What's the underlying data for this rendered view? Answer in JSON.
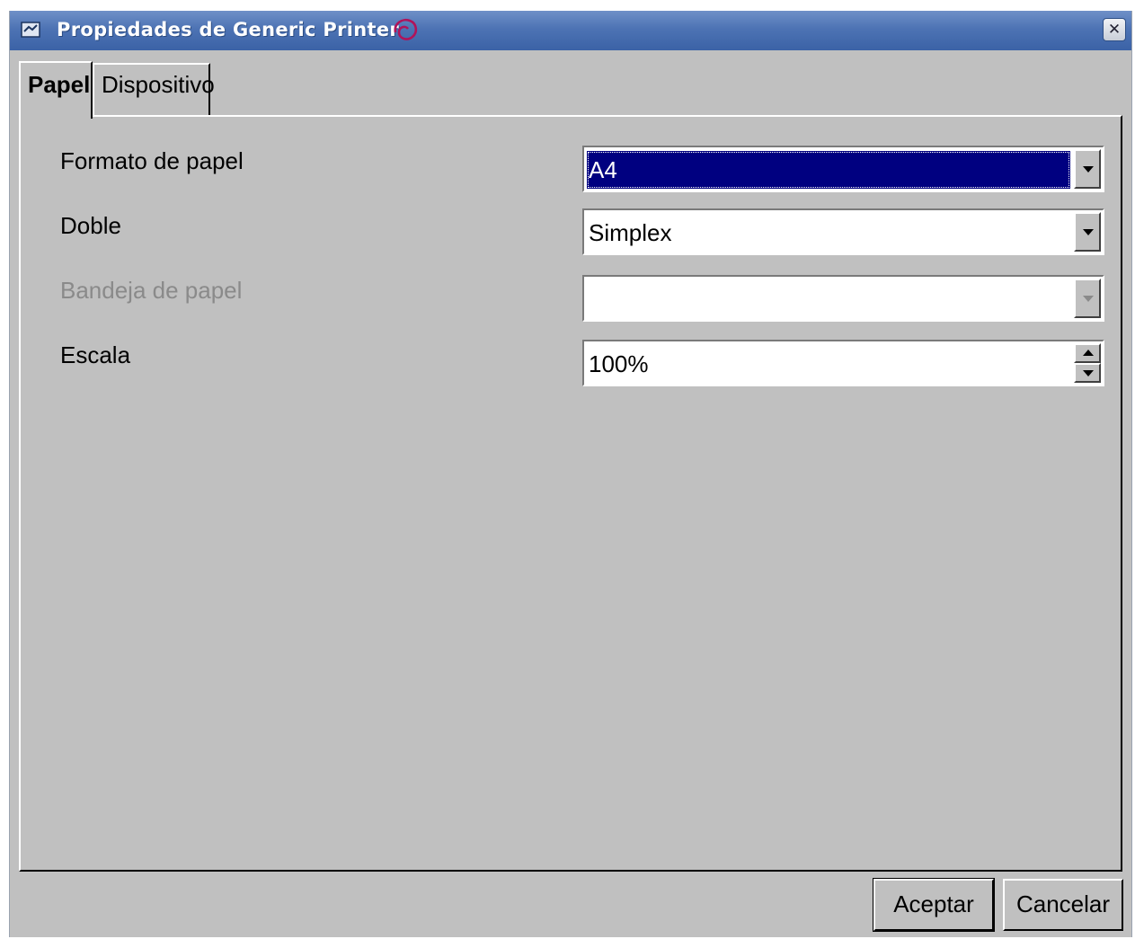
{
  "window": {
    "title": "Propiedades de Generic Printer"
  },
  "tabs": [
    {
      "label": "Papel",
      "active": true
    },
    {
      "label": "Dispositivo",
      "active": false
    }
  ],
  "form": {
    "paper_format": {
      "label": "Formato de papel",
      "value": "A4"
    },
    "duplex": {
      "label": "Doble",
      "value": "Simplex"
    },
    "paper_tray": {
      "label": "Bandeja de papel",
      "value": "",
      "enabled": false
    },
    "scale": {
      "label": "Escala",
      "value": "100%"
    }
  },
  "buttons": {
    "ok_label": "Aceptar",
    "cancel_label": "Cancelar"
  },
  "colors": {
    "titlebar": "#4d73b4",
    "dialog_bg": "#c0c0c0",
    "selection": "#000080"
  }
}
